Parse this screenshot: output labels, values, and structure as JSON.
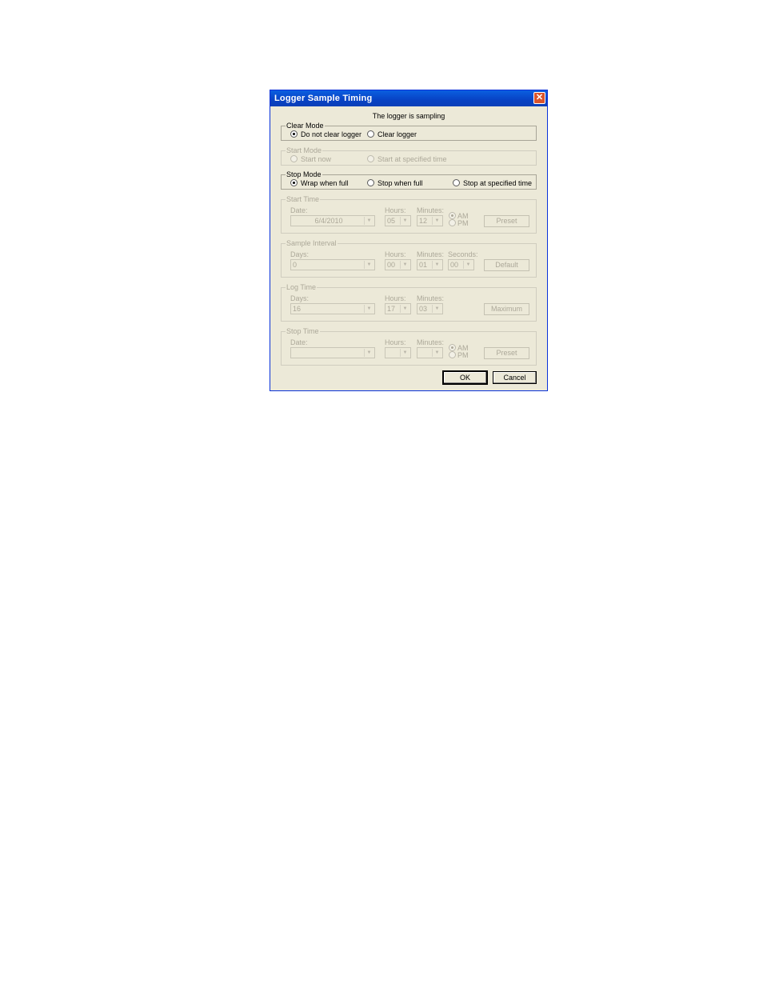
{
  "window": {
    "title": "Logger Sample Timing",
    "close_glyph": "✕"
  },
  "status_text": "The logger is sampling",
  "clear_mode": {
    "label": "Clear Mode",
    "options": [
      "Do not clear logger",
      "Clear logger"
    ],
    "selected": 0
  },
  "start_mode": {
    "label": "Start Mode",
    "options": [
      "Start now",
      "Start at specified time"
    ]
  },
  "stop_mode": {
    "label": "Stop Mode",
    "options": [
      "Wrap when full",
      "Stop when full",
      "Stop at specified time"
    ],
    "selected": 0
  },
  "start_time": {
    "label": "Start Time",
    "date_label": "Date:",
    "hours_label": "Hours:",
    "minutes_label": "Minutes:",
    "date": "6/4/2010",
    "hours": "05",
    "minutes": "12",
    "am": "AM",
    "pm": "PM",
    "preset": "Preset"
  },
  "sample_interval": {
    "label": "Sample Interval",
    "days_label": "Days:",
    "hours_label": "Hours:",
    "minutes_label": "Minutes:",
    "seconds_label": "Seconds:",
    "days": "0",
    "hours": "00",
    "minutes": "01",
    "seconds": "00",
    "default": "Default"
  },
  "log_time": {
    "label": "Log Time",
    "days_label": "Days:",
    "hours_label": "Hours:",
    "minutes_label": "Minutes:",
    "days": "16",
    "hours": "17",
    "minutes": "03",
    "maximum": "Maximum"
  },
  "stop_time": {
    "label": "Stop Time",
    "date_label": "Date:",
    "hours_label": "Hours:",
    "minutes_label": "Minutes:",
    "date": "",
    "hours": "",
    "minutes": "",
    "am": "AM",
    "pm": "PM",
    "preset": "Preset"
  },
  "buttons": {
    "ok": "OK",
    "cancel": "Cancel"
  },
  "icons": {
    "dropdown": "chevron-down-icon",
    "radio": "radio-icon"
  },
  "colors": {
    "titlebar": "#0a5fe0",
    "dialog_bg": "#ece9d8",
    "close": "#d9542c"
  }
}
